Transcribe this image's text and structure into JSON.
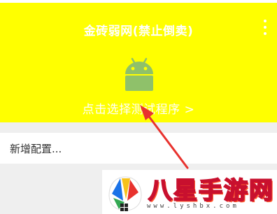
{
  "app": {
    "title": "金砖弱网(禁止倒卖)",
    "select_program": "点击选择测试程序 >",
    "menu_icon": "more-vert-icon",
    "android_icon": "android-icon"
  },
  "config": {
    "add_label": "新增配置..."
  },
  "watermark": {
    "name": "八星手游网",
    "url": "www.lyshbx.com"
  },
  "colors": {
    "header_bg": "#ffff00",
    "android_green": "#8fc16a",
    "arrow_red": "#e8322e",
    "page_bg": "#efefef"
  }
}
